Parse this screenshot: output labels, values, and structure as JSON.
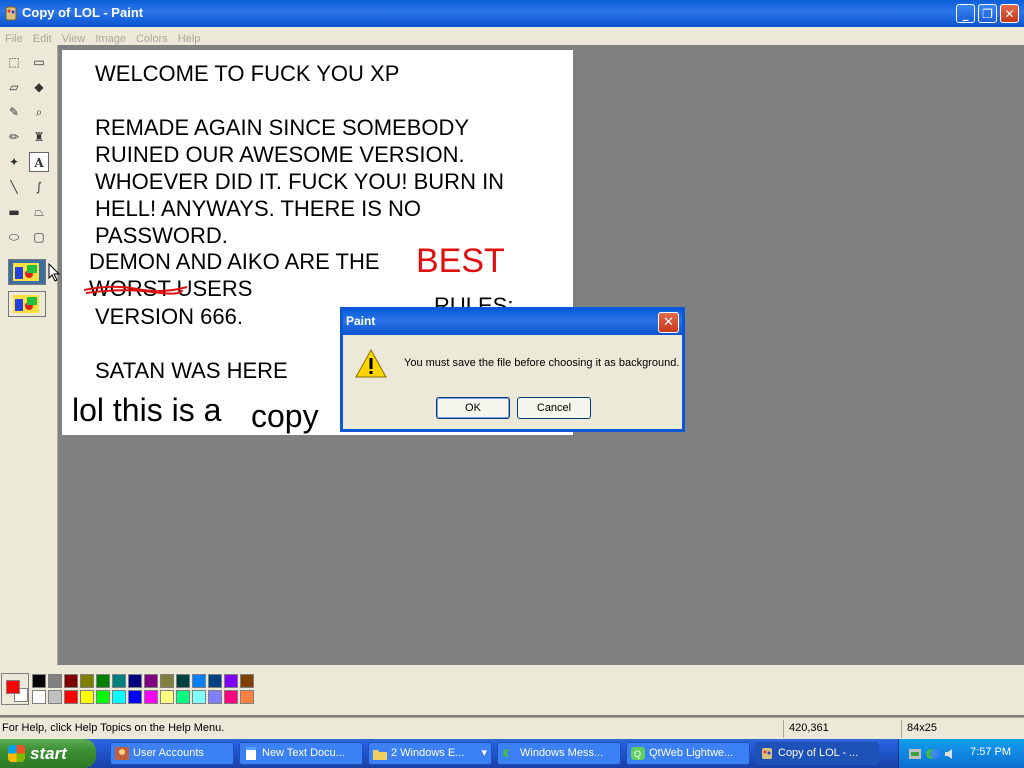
{
  "window": {
    "title": "Copy of LOL - Paint",
    "minimize": "_",
    "maximize": "❐",
    "close": "✕"
  },
  "menu": [
    "File",
    "Edit",
    "View",
    "Image",
    "Colors",
    "Help"
  ],
  "toolbox": {
    "tools": [
      {
        "name": "free-form-select",
        "glyph": "⬚"
      },
      {
        "name": "select",
        "glyph": "▭"
      },
      {
        "name": "eraser",
        "glyph": "▱"
      },
      {
        "name": "fill",
        "glyph": "◆"
      },
      {
        "name": "pick-color",
        "glyph": "✎"
      },
      {
        "name": "magnifier",
        "glyph": "⌕"
      },
      {
        "name": "pencil",
        "glyph": "✏"
      },
      {
        "name": "brush",
        "glyph": "♜"
      },
      {
        "name": "airbrush",
        "glyph": "✦"
      },
      {
        "name": "text",
        "glyph": "A"
      },
      {
        "name": "line",
        "glyph": "╲"
      },
      {
        "name": "curve",
        "glyph": "∫"
      },
      {
        "name": "rectangle",
        "glyph": "▬"
      },
      {
        "name": "polygon",
        "glyph": "⏢"
      },
      {
        "name": "ellipse",
        "glyph": "⬭"
      },
      {
        "name": "rounded-rectangle",
        "glyph": "▢"
      }
    ],
    "selected": "text"
  },
  "canvas": {
    "lines": [
      "WELCOME TO FUCK YOU XP",
      "REMADE AGAIN SINCE SOMEBODY",
      "RUINED OUR AWESOME VERSION.",
      "WHOEVER DID IT. FUCK YOU! BURN IN",
      "HELL! ANYWAYS. THERE IS NO",
      "PASSWORD.",
      "DEMON AND AIKO ARE THE",
      "WORST USERS",
      "VERSION 666.",
      "SATAN WAS HERE",
      "lol this is a",
      "copy"
    ],
    "best": "BEST",
    "rules": "RULES:",
    "best_color": "#e01010"
  },
  "palette": {
    "primary": "#ff0000",
    "secondary": "#ffffff",
    "row1": [
      "#000000",
      "#808080",
      "#800000",
      "#808000",
      "#008000",
      "#008080",
      "#000080",
      "#800080",
      "#808040",
      "#004040",
      "#0080ff",
      "#004080",
      "#8000ff",
      "#804000"
    ],
    "row2": [
      "#ffffff",
      "#c0c0c0",
      "#ff0000",
      "#ffff00",
      "#00ff00",
      "#00ffff",
      "#0000ff",
      "#ff00ff",
      "#ffff80",
      "#00ff80",
      "#80ffff",
      "#8080ff",
      "#ff0080",
      "#ff8040"
    ]
  },
  "status": {
    "help": "For Help, click Help Topics on the Help Menu.",
    "coords": "420,361",
    "size": "84x25"
  },
  "taskbar": {
    "start": "start",
    "tasks": [
      "User Accounts",
      "New Text Docu...",
      "2 Windows E...",
      "Windows Mess...",
      "QtWeb Lightwe...",
      "Copy of LOL - ..."
    ],
    "clock": "7:57 PM"
  },
  "dialog": {
    "title": "Paint",
    "message": "You must save the file before choosing it as background.",
    "ok": "OK",
    "cancel": "Cancel",
    "icon": "warning-icon"
  }
}
